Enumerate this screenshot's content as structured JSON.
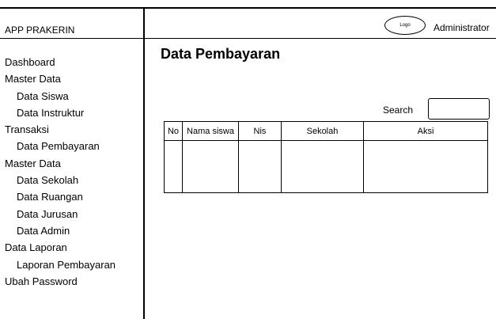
{
  "app": {
    "title": "APP PRAKERIN"
  },
  "header": {
    "logo_text": "Logo",
    "user": "Administrator"
  },
  "sidebar": {
    "items": [
      {
        "label": "Dashboard",
        "level": 0
      },
      {
        "label": "Master Data",
        "level": 0
      },
      {
        "label": "Data Siswa",
        "level": 1
      },
      {
        "label": "Data Instruktur",
        "level": 1
      },
      {
        "label": "Transaksi",
        "level": 0
      },
      {
        "label": "Data Pembayaran",
        "level": 1
      },
      {
        "label": "Master Data",
        "level": 0
      },
      {
        "label": "Data Sekolah",
        "level": 1
      },
      {
        "label": "Data Ruangan",
        "level": 1
      },
      {
        "label": "Data Jurusan",
        "level": 1
      },
      {
        "label": "Data Admin",
        "level": 1
      },
      {
        "label": "Data Laporan",
        "level": 0
      },
      {
        "label": "Laporan Pembayaran",
        "level": 1
      },
      {
        "label": "Ubah Password",
        "level": 0
      }
    ]
  },
  "main": {
    "title": "Data Pembayaran",
    "search": {
      "label": "Search",
      "value": ""
    },
    "table": {
      "columns": [
        "No",
        "Nama siswa",
        "Nis",
        "Sekolah",
        "Aksi"
      ],
      "rows": [
        [
          "",
          "",
          "",
          "",
          ""
        ]
      ]
    }
  }
}
